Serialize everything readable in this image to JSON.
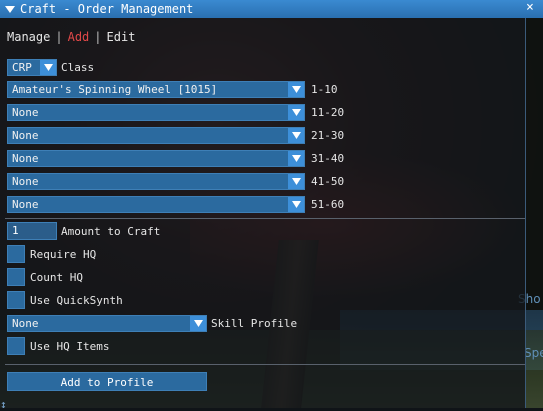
{
  "window": {
    "title": "Craft - Order Management",
    "close_glyph": "×"
  },
  "menu": {
    "items": [
      "Manage",
      "Add",
      "Edit"
    ],
    "separator": "|"
  },
  "class_select": {
    "value": "CRP",
    "label": "Class"
  },
  "level_ranges": [
    {
      "value": "Amateur's Spinning Wheel [1015]",
      "label": "1-10"
    },
    {
      "value": "None",
      "label": "11-20"
    },
    {
      "value": "None",
      "label": "21-30"
    },
    {
      "value": "None",
      "label": "31-40"
    },
    {
      "value": "None",
      "label": "41-50"
    },
    {
      "value": "None",
      "label": "51-60"
    }
  ],
  "amount": {
    "value": "1",
    "label": "Amount to Craft"
  },
  "checkboxes": [
    "Require HQ",
    "Count HQ",
    "Use QuickSynth"
  ],
  "skill_profile": {
    "value": "None",
    "label": "Skill Profile"
  },
  "hq_items": {
    "label": "Use HQ Items"
  },
  "add_button": {
    "label": "Add to Profile"
  },
  "background_text": [
    "Sho",
    "Spe"
  ],
  "colors": {
    "accent": "#2b6a9f",
    "title_bar": "#2f7cc2",
    "active_tab": "#e04848"
  }
}
